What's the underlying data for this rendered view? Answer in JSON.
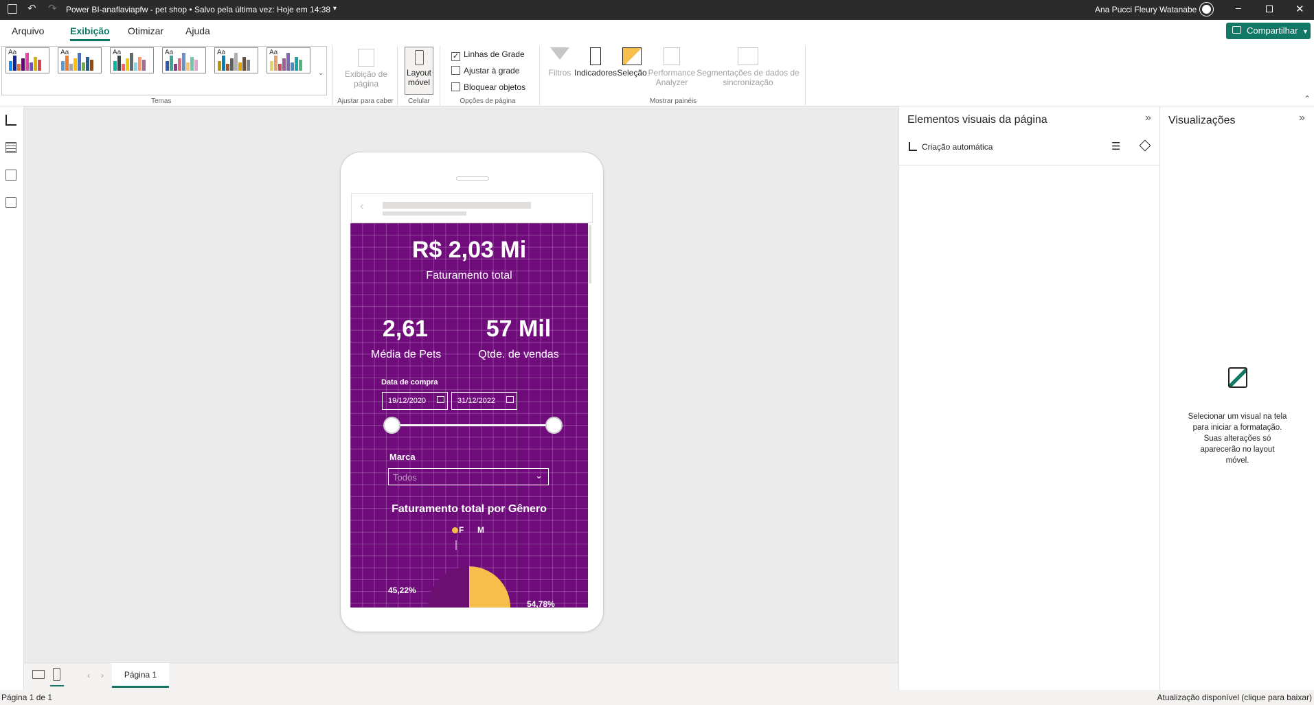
{
  "titlebar": {
    "title": "Power BI-anaflaviapfw - pet shop • Salvo pela última vez: Hoje em 14:38",
    "user": "Ana Pucci Fleury Watanabe"
  },
  "menu": {
    "tabs": [
      "Arquivo",
      "Exibição",
      "Otimizar",
      "Ajuda"
    ],
    "active_tab": "Exibição",
    "share_label": "Compartilhar"
  },
  "ribbon": {
    "groups": {
      "themes": "Temas",
      "fit": "Ajustar para caber",
      "phone": "Celular",
      "page_options": "Opções de página",
      "panels": "Mostrar painéis"
    },
    "page_view_label": "Exibição de página",
    "mobile_layout_label": "Layout móvel",
    "checkboxes": [
      {
        "label": "Linhas de Grade",
        "checked": true
      },
      {
        "label": "Ajustar à grade",
        "checked": false
      },
      {
        "label": "Bloquear objetos",
        "checked": false
      }
    ],
    "panel_buttons": {
      "filters": "Filtros",
      "bookmarks": "Indicadores",
      "selection": "Seleção",
      "performance": "Performance Analyzer",
      "sync": "Segmentações de dados de sincronização"
    },
    "themes": [
      {
        "aa": "Aa",
        "colors": [
          "#118dff",
          "#12239e",
          "#e66c37",
          "#6b007b",
          "#e044a7",
          "#744ec2",
          "#d9b300",
          "#d64550"
        ]
      },
      {
        "aa": "Aa",
        "colors": [
          "#5b9bd5",
          "#ed7d31",
          "#a5a5a5",
          "#ffc000",
          "#4472c4",
          "#70ad47",
          "#255e91",
          "#9e480e"
        ]
      },
      {
        "aa": "Aa",
        "colors": [
          "#01b8aa",
          "#374649",
          "#fd625e",
          "#f2c80f",
          "#5f6b6d",
          "#8ad4eb",
          "#fe9666",
          "#a66999"
        ]
      },
      {
        "aa": "Aa",
        "colors": [
          "#3257a8",
          "#37a794",
          "#8b3d88",
          "#dd6b7f",
          "#6b91c9",
          "#f5c869",
          "#77c4a8",
          "#dea6cf"
        ]
      },
      {
        "aa": "Aa",
        "colors": [
          "#b6960b",
          "#0b7eb6",
          "#a65628",
          "#5f5f5f",
          "#b0b0b0",
          "#e1a200",
          "#6d4e3b",
          "#848484"
        ]
      },
      {
        "aa": "Aa",
        "colors": [
          "#e8d166",
          "#e6a26b",
          "#cc4c5e",
          "#9e5d9a",
          "#7d6bb2",
          "#4c8ec4",
          "#1fa2a8",
          "#54b47e"
        ]
      }
    ]
  },
  "report": {
    "kpi_main_value": "R$ 2,03 Mi",
    "kpi_main_label": "Faturamento total",
    "kpi2_value": "2,61",
    "kpi2_label": "Média de Pets",
    "kpi3_value": "57 Mil",
    "kpi3_label": "Qtde. de vendas",
    "date_slicer_title": "Data de compra",
    "date_start": "19/12/2020",
    "date_end": "31/12/2022",
    "brand_slicer_title": "Marca",
    "brand_value": "Todos",
    "pie_title": "Faturamento total por Gênero",
    "legend_f": "F",
    "legend_m": "M",
    "pct_m": "45,22%",
    "pct_f": "54,78%",
    "color_f": "#f6bf4b",
    "color_m": "#6b1070"
  },
  "chart_data": {
    "type": "pie",
    "title": "Faturamento total por Gênero",
    "categories": [
      "F",
      "M"
    ],
    "values": [
      54.78,
      45.22
    ]
  },
  "page_tabs": {
    "page1": "Página 1"
  },
  "status": {
    "left": "Página 1 de 1",
    "right": "Atualização disponível (clique para baixar)"
  },
  "visual_elements_pane": {
    "title": "Elementos visuais da página",
    "auto_create": "Criação automática"
  },
  "visualizations_pane": {
    "title": "Visualizações",
    "hint": "Selecionar um visual na tela para iniciar a formatação. Suas alterações só aparecerão no layout móvel."
  }
}
